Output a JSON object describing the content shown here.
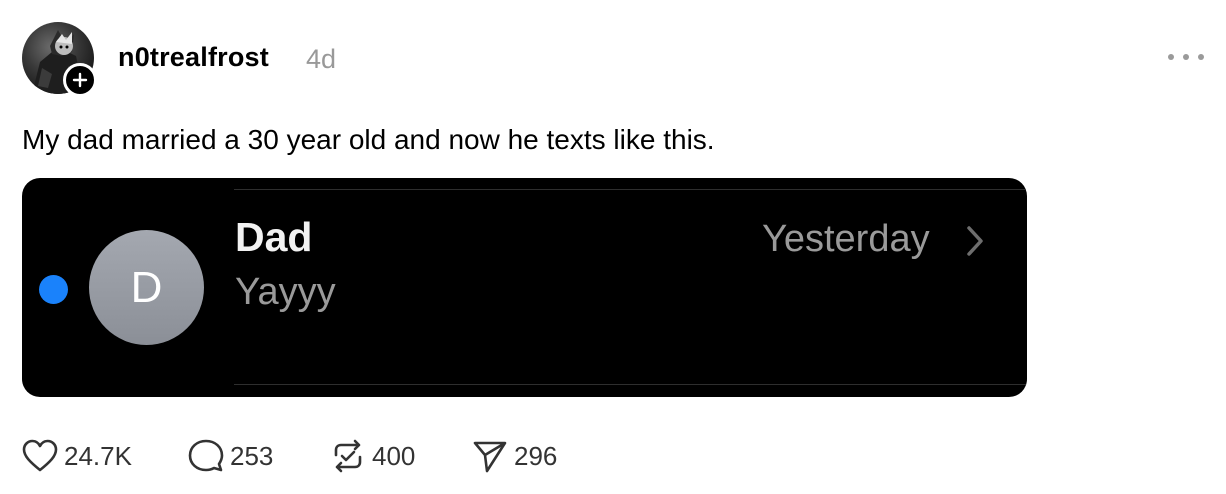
{
  "post": {
    "username": "n0trealfrost",
    "time_ago": "4d",
    "caption": "My dad married a 30 year old and now he texts like this.",
    "follow_icon": "plus-icon",
    "more_icon": "more-horizontal-icon"
  },
  "screenshot": {
    "contact_name": "Dad",
    "contact_initial": "D",
    "message_preview": "Yayyy",
    "timestamp": "Yesterday",
    "unread_color": "#1a82fb"
  },
  "actions": {
    "likes": "24.7K",
    "replies": "253",
    "reposts": "400",
    "shares": "296"
  }
}
